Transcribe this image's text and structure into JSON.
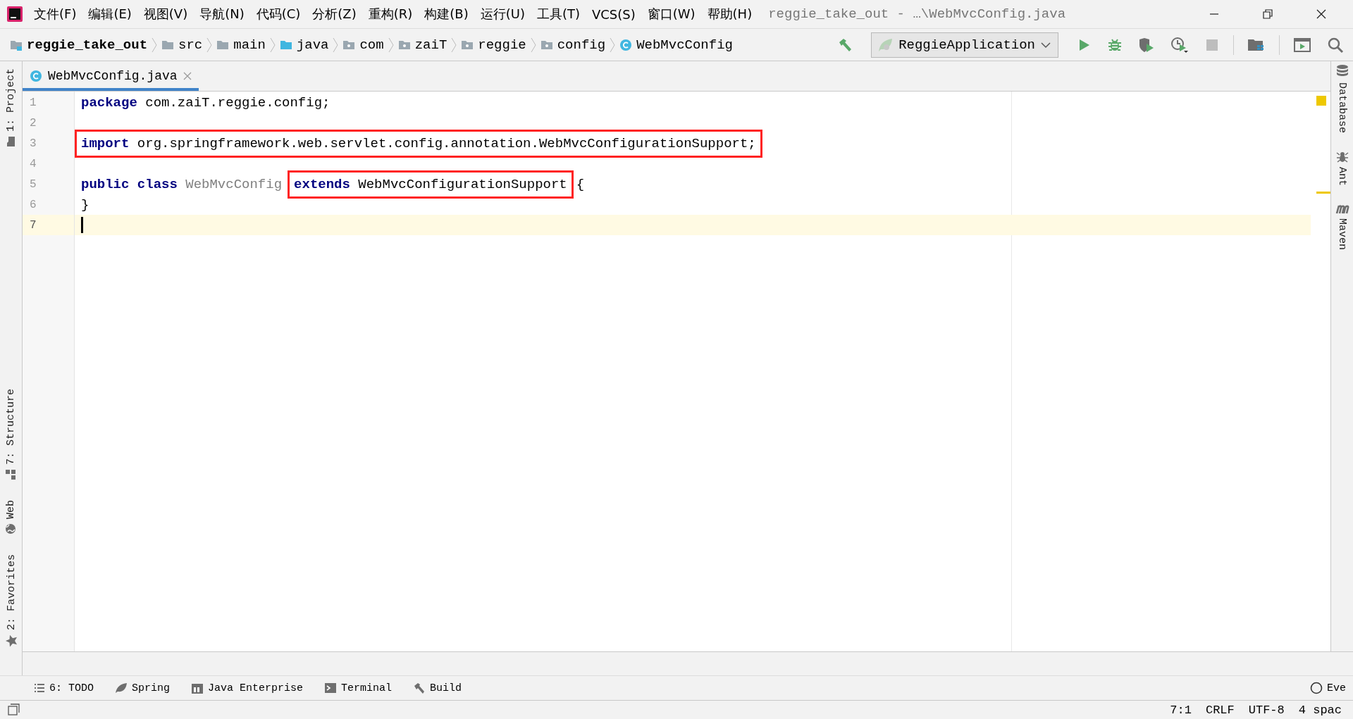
{
  "window": {
    "title": "reggie_take_out - …\\WebMvcConfig.java"
  },
  "menu": [
    "文件(F)",
    "编辑(E)",
    "视图(V)",
    "导航(N)",
    "代码(C)",
    "分析(Z)",
    "重构(R)",
    "构建(B)",
    "运行(U)",
    "工具(T)",
    "VCS(S)",
    "窗口(W)",
    "帮助(H)"
  ],
  "breadcrumbs": [
    {
      "label": "reggie_take_out",
      "kind": "module"
    },
    {
      "label": "src",
      "kind": "folder"
    },
    {
      "label": "main",
      "kind": "folder"
    },
    {
      "label": "java",
      "kind": "source"
    },
    {
      "label": "com",
      "kind": "package"
    },
    {
      "label": "zaiT",
      "kind": "package"
    },
    {
      "label": "reggie",
      "kind": "package"
    },
    {
      "label": "config",
      "kind": "package"
    },
    {
      "label": "WebMvcConfig",
      "kind": "class"
    }
  ],
  "toolbar": {
    "run_configuration": "ReggieApplication",
    "buttons": [
      {
        "kind": "run",
        "disabled": false
      },
      {
        "kind": "debug",
        "disabled": false
      },
      {
        "kind": "coverage",
        "disabled": false
      },
      {
        "kind": "profile",
        "disabled": false
      },
      {
        "kind": "stop",
        "disabled": true
      },
      {
        "kind": "project_structure",
        "disabled": false
      },
      {
        "kind": "run_window",
        "disabled": false
      },
      {
        "kind": "search",
        "disabled": false
      }
    ]
  },
  "left_stripe": {
    "top": [
      {
        "label": "1: Project",
        "kind": "project"
      }
    ],
    "bottom": [
      {
        "label": "7: Structure",
        "kind": "structure"
      },
      {
        "label": "Web",
        "kind": "web"
      },
      {
        "label": "2: Favorites",
        "kind": "favorites"
      }
    ]
  },
  "right_stripe": [
    {
      "label": "Database",
      "kind": "database"
    },
    {
      "label": "Ant",
      "kind": "ant"
    },
    {
      "label": "Maven",
      "kind": "maven"
    }
  ],
  "editor_tabs": [
    {
      "label": "WebMvcConfig.java",
      "selected": true
    }
  ],
  "lines": [
    {
      "number": "1",
      "current": false,
      "spans": [
        {
          "boxed": false,
          "tokens": [
            {
              "kind": "keyword",
              "text": "package"
            },
            {
              "kind": "plain",
              "text": "com.zaiT.reggie.config;"
            }
          ]
        }
      ]
    },
    {
      "number": "2",
      "current": false
    },
    {
      "number": "3",
      "current": false,
      "spans": [
        {
          "boxed": true,
          "tokens": [
            {
              "kind": "keyword",
              "text": "import"
            },
            {
              "kind": "plain",
              "text": "org.springframework.web.servlet.config.annotation.WebMvcConfigurationSupport;"
            }
          ]
        }
      ]
    },
    {
      "number": "4",
      "current": false
    },
    {
      "number": "5",
      "current": false,
      "spans": [
        {
          "boxed": false,
          "tokens": [
            {
              "kind": "keyword",
              "text": "public"
            },
            {
              "kind": "keyword",
              "text": "class"
            },
            {
              "kind": "unused",
              "text": "WebMvcConfig"
            }
          ]
        },
        {
          "boxed": true,
          "tokens": [
            {
              "kind": "keyword",
              "text": "extends"
            },
            {
              "kind": "plain",
              "text": "WebMvcConfigurationSupport"
            }
          ]
        },
        {
          "boxed": false,
          "tokens": [
            {
              "kind": "plain",
              "text": "{"
            }
          ]
        }
      ]
    },
    {
      "number": "6",
      "current": false,
      "spans": [
        {
          "boxed": false,
          "tokens": [
            {
              "kind": "plain",
              "text": "}"
            }
          ]
        }
      ]
    },
    {
      "number": "7",
      "current": true
    }
  ],
  "tool_windows": [
    {
      "label": "6: TODO",
      "kind": "todo"
    },
    {
      "label": "Spring",
      "kind": "spring"
    },
    {
      "label": "Java Enterprise",
      "kind": "enterprise"
    },
    {
      "label": "Terminal",
      "kind": "terminal"
    },
    {
      "label": "Build",
      "kind": "build"
    }
  ],
  "tool_windows_right": [
    {
      "label": "Eve",
      "kind": "event_log"
    }
  ],
  "status_bar": [
    "7:1",
    "CRLF",
    "UTF-8",
    "4 spac"
  ]
}
